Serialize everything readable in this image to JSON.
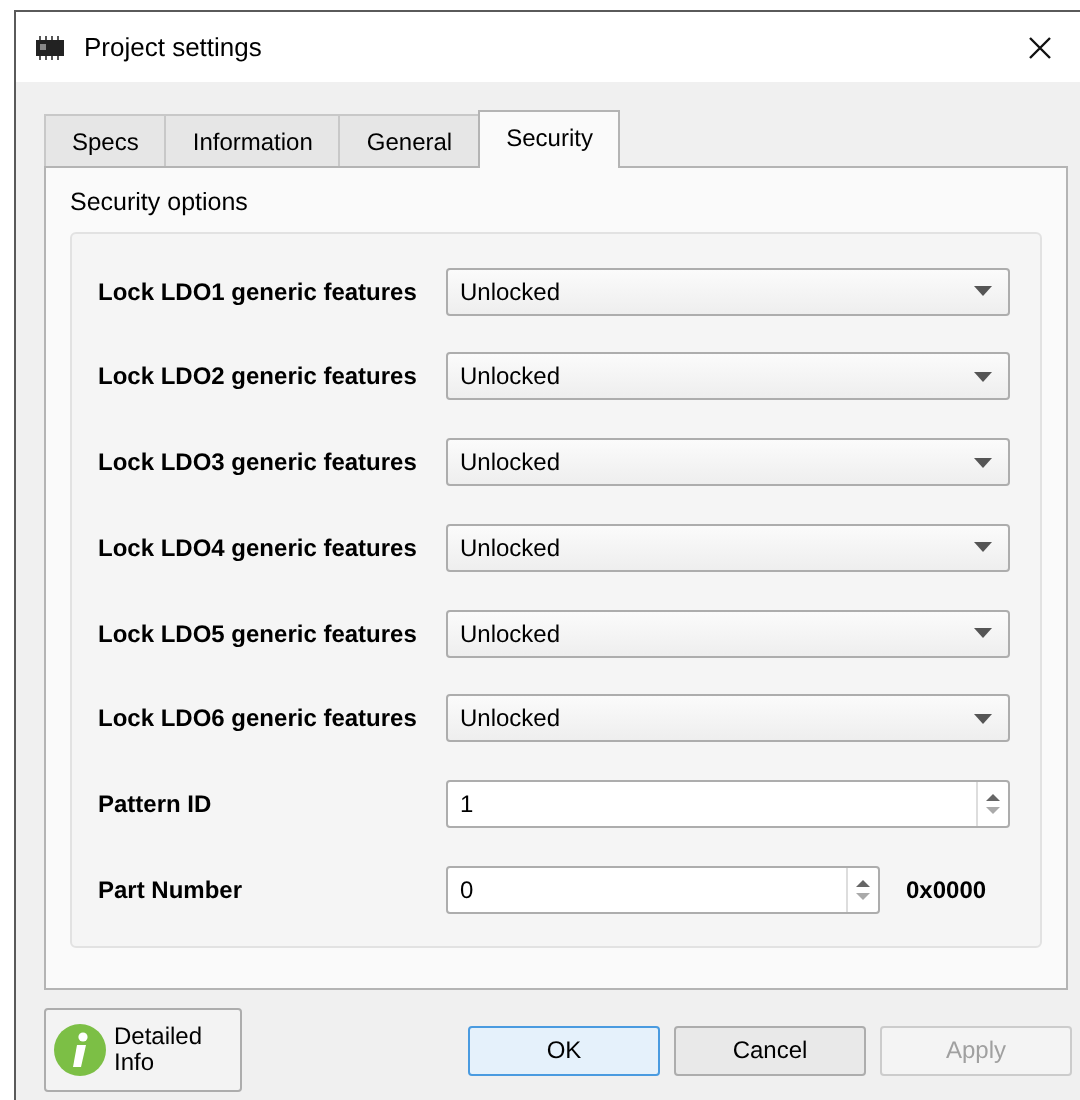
{
  "window": {
    "title": "Project settings"
  },
  "tabs": [
    {
      "label": "Specs",
      "selected": false
    },
    {
      "label": "Information",
      "selected": false
    },
    {
      "label": "General",
      "selected": false
    },
    {
      "label": "Security",
      "selected": true
    }
  ],
  "group": {
    "title": "Security options"
  },
  "fields": [
    {
      "kind": "dropdown",
      "label": "Lock LDO1 generic features",
      "value": "Unlocked"
    },
    {
      "kind": "dropdown",
      "label": "Lock LDO2 generic features",
      "value": "Unlocked"
    },
    {
      "kind": "dropdown",
      "label": "Lock LDO3 generic features",
      "value": "Unlocked"
    },
    {
      "kind": "dropdown",
      "label": "Lock LDO4 generic features",
      "value": "Unlocked"
    },
    {
      "kind": "dropdown",
      "label": "Lock LDO5 generic features",
      "value": "Unlocked"
    },
    {
      "kind": "dropdown",
      "label": "Lock LDO6 generic features",
      "value": "Unlocked"
    },
    {
      "kind": "spin",
      "label": "Pattern ID",
      "value": "1"
    },
    {
      "kind": "spin",
      "label": "Part Number",
      "value": "0",
      "suffix": "0x0000"
    }
  ],
  "info_button": {
    "label": "Detailed Info"
  },
  "buttons": [
    {
      "label": "OK",
      "disabled": false,
      "default": true
    },
    {
      "label": "Cancel",
      "disabled": false,
      "default": false
    },
    {
      "label": "Apply",
      "disabled": true,
      "default": false
    }
  ]
}
